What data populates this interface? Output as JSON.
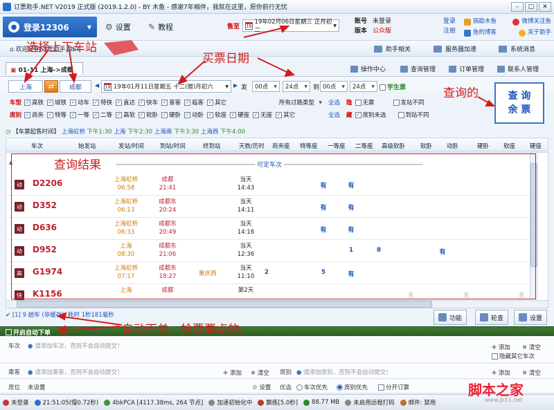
{
  "window": {
    "title": "订票助手.NET V2019 正式版 (2019.1.2.0) - BY 木鱼 - 感谢7年相伴，我就在这里，愿你前行无忧",
    "min": "–",
    "max": "□",
    "close": "✕"
  },
  "menu": {
    "login": "登录12306",
    "settings": "设置",
    "tutorial": "教程"
  },
  "sale": {
    "label": "售至",
    "date": "19年02月06日星期三 正月初二"
  },
  "account": {
    "k1": "账号",
    "v1": "未登录",
    "k2": "版本",
    "v2": "公众版",
    "login_link": "登录",
    "register_link": "注册"
  },
  "quick_links": [
    "捐助木鱼",
    "微博关注鱼",
    "鱼的博客",
    "关于助手"
  ],
  "toolbar2": {
    "welcome": "欢迎使用订票助手.NET",
    "helper": "助手相关",
    "accel": "服务器加速",
    "msg": "系统消息"
  },
  "tab": {
    "label": "01-11  上海->成都"
  },
  "toolbar3": {
    "op": "操作中心",
    "query_mgr": "查询管理",
    "order_mgr": "订单管理",
    "contact_mgr": "联系人管理"
  },
  "query": {
    "from": "上海",
    "to": "成都",
    "swap": "⇄",
    "date": "19年01月11日星期五 十二(腊)月初六",
    "depart": "发",
    "t1": "00点",
    "t2": "24点",
    "to_lbl": "到",
    "t3": "00点",
    "t4": "24点",
    "student": "学生票"
  },
  "filters": {
    "type_label": "车型",
    "types": [
      "高铁",
      "城铁",
      "动车",
      "特快",
      "直达",
      "快车",
      "普客",
      "临客",
      "其它"
    ],
    "station_filter": "所有过路类型",
    "all1": "全选",
    "seat_label": "席别",
    "seats": [
      "商务",
      "特等",
      "一等",
      "二等",
      "高软",
      "软卧",
      "硬卧",
      "动卧",
      "软座",
      "硬座",
      "无座",
      "其它"
    ],
    "all2": "全选",
    "hide_label": "隐",
    "hide_opts": [
      "无票",
      "发站不同"
    ],
    "hide2_label": "藏",
    "hide2_opts": [
      "席别未选",
      "到站不同"
    ]
  },
  "query_button": {
    "line1": "查 询",
    "line2": "余 票"
  },
  "sale_times": {
    "head": "【车票起售时间】",
    "items": [
      {
        "stn": "上海虹桥",
        "time": "下午1:30"
      },
      {
        "stn": "上海",
        "time": "下午2:30"
      },
      {
        "stn": "上海南",
        "time": "下午3:30"
      },
      {
        "stn": "上海西",
        "time": "下午4:00"
      }
    ]
  },
  "table": {
    "headers": [
      "车次",
      "始发站",
      "发站/时间",
      "到站/时间",
      "终到站",
      "天数/历时",
      "商务座",
      "特等座",
      "一等座",
      "二等座",
      "高级软卧",
      "软卧",
      "动卧",
      "硬卧",
      "软座",
      "硬座"
    ],
    "group": "可定车次",
    "rows": [
      {
        "badge": "动",
        "no": "D2206",
        "from": "上海虹桥",
        "dep": "06:58",
        "to": "成都",
        "arr": "21:41",
        "term": "",
        "days": "当天",
        "dur": "14:43",
        "s1": "",
        "s3": "有",
        "s4": "有",
        "s5": "",
        "s6": ""
      },
      {
        "badge": "动",
        "no": "D352",
        "from": "上海虹桥",
        "dep": "06:13",
        "to": "成都东",
        "arr": "20:24",
        "term": "",
        "days": "当天",
        "dur": "14:11",
        "s1": "",
        "s3": "有",
        "s4": "有",
        "s5": "",
        "s6": ""
      },
      {
        "badge": "动",
        "no": "D636",
        "from": "上海虹桥",
        "dep": "06:33",
        "to": "成都东",
        "arr": "20:49",
        "term": "",
        "days": "当天",
        "dur": "14:16",
        "s1": "",
        "s3": "有",
        "s4": "有",
        "s5": "",
        "s6": ""
      },
      {
        "badge": "动",
        "no": "D952",
        "from": "上海",
        "dep": "08:30",
        "to": "成都东",
        "arr": "21:06",
        "term": "",
        "days": "当天",
        "dur": "12:36",
        "s1": "",
        "s3": "",
        "s4": "1",
        "s5": "8",
        "s6": "有"
      },
      {
        "badge": "高",
        "no": "G1974",
        "from": "上海虹桥",
        "dep": "07:17",
        "to": "成都东",
        "arr": "18:27",
        "term": "重庆西",
        "days": "当天",
        "dur": "11:10",
        "s1": "2",
        "s3": "5",
        "s4": "有",
        "s5": "",
        "s6": ""
      },
      {
        "badge": "快",
        "no": "K1156",
        "from": "上海",
        "dep": "",
        "to": "成都",
        "arr": "",
        "term": "",
        "days": "第2天",
        "dur": "",
        "s1": "",
        "s3": "",
        "s4": "",
        "s5": "",
        "s6": ""
      }
    ],
    "none_mark": "无"
  },
  "status": {
    "text": "[1] 9 趟车 (非缓存), 耗时 1秒181毫秒"
  },
  "buttons": {
    "func": "功能",
    "check": "轮查",
    "settings": "设置"
  },
  "auto": {
    "label": "开启自动下单",
    "train_lbl": "车次",
    "train_ph": "请添加车次，否则不会自动提交！",
    "add": "添加",
    "clear": "清空",
    "hide_other": "隐藏其它车次",
    "passenger_lbl": "乘客",
    "passenger_ph": "请添加乘客，否则不会自动提交！",
    "seat_lbl": "席别",
    "seat_ph": "请添加席别，否则不会自动提交！",
    "pos_lbl": "席位",
    "pos_val": "未设置",
    "set": "设置",
    "prio": "优选",
    "prio1": "车次优先",
    "prio2": "席别优先",
    "split": "分开订票"
  },
  "statusbar": [
    "未登录",
    "21:51:05(慢0.72秒)",
    "4bkPCA [4117.38ms, 264 节点]",
    "加速初始化中",
    "飘练[5.0秒]",
    "88.77 MB",
    "未启用远程打码",
    "邮件: 禁用"
  ],
  "annotations": {
    "a1": "选择上下车站",
    "a2": "买票日期",
    "a3": "查询的",
    "a4": "查询结果",
    "a5": "自动下单，抢票要点的。"
  },
  "watermark": {
    "main": "脚本之家",
    "sub": "www.jb51.net"
  },
  "colors": {
    "accent": "#1a56b8",
    "red": "#d21c1c",
    "green": "#2a5d22"
  }
}
